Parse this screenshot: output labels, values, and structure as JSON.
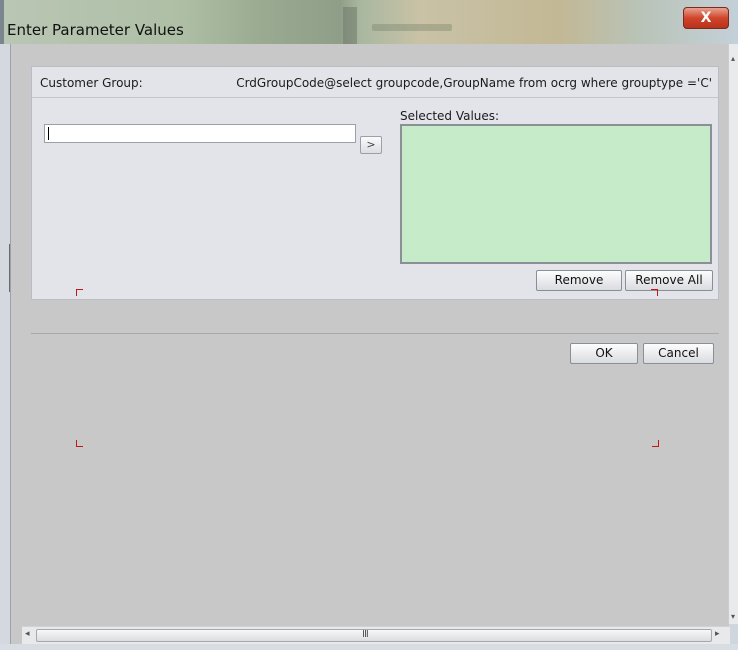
{
  "window": {
    "title": "Enter Parameter Values",
    "close_glyph": "X"
  },
  "parameter": {
    "label": "Customer Group:",
    "query": "CrdGroupCode@select groupcode,GroupName from ocrg where grouptype ='C'",
    "input_value": "",
    "add_glyph": ">",
    "selected_label": "Selected Values:",
    "selected_values": [],
    "selected_bg": "#c6ebc9"
  },
  "buttons": {
    "remove": "Remove",
    "remove_all": "Remove All",
    "ok": "OK",
    "cancel": "Cancel"
  },
  "scrollbar": {
    "left_glyph": "◂",
    "right_glyph": "▸",
    "grip": "III",
    "up_glyph": "▴",
    "down_glyph": "▾"
  },
  "colors": {
    "close_button": "#d0452b",
    "crop_marks": "#c01818"
  }
}
